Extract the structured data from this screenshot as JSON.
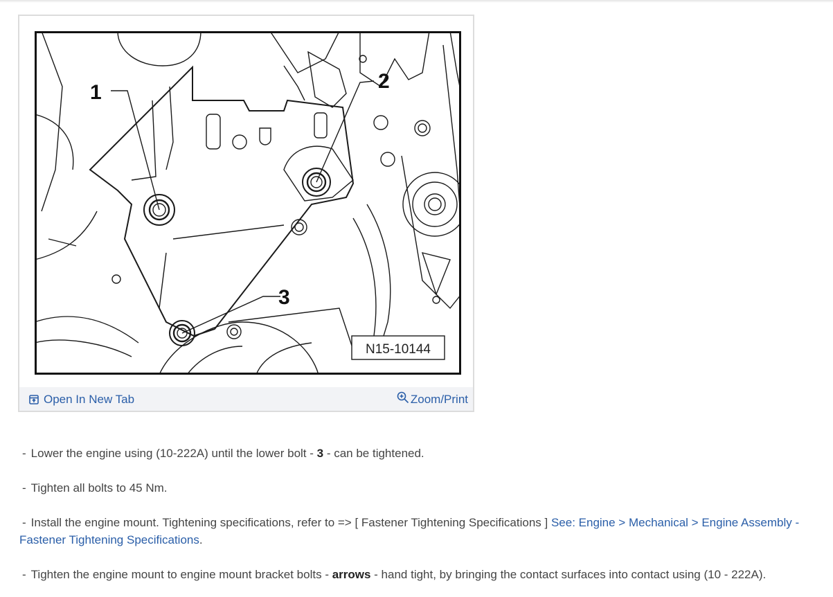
{
  "figure": {
    "image_code": "N15-10144",
    "callouts": [
      "1",
      "2",
      "3"
    ],
    "open_label": "Open In New Tab",
    "zoom_label": "Zoom/Print",
    "open_icon": "open-in-new-tab-icon",
    "zoom_icon": "zoom-in-icon",
    "link_color": "#2a5ea8"
  },
  "steps": [
    {
      "dash": "-",
      "pre": "Lower the engine using (10-222A) until the lower bolt - ",
      "bold": "3",
      "post": " - can be tightened."
    },
    {
      "dash": "-",
      "text": "Tighten all bolts to 45 Nm."
    },
    {
      "dash": "-",
      "pre": "Install the engine mount. Tightening specifications, refer to => [ Fastener Tightening Specifications ] ",
      "link": "See: Engine > Mechanical > Engine Assembly - Fastener Tightening Specifications",
      "post": "."
    },
    {
      "dash": "-",
      "pre": "Tighten the engine mount to engine mount bracket bolts - ",
      "bold": "arrows",
      "post": " - hand tight, by bringing the contact surfaces into contact using (10 - 222A)."
    }
  ]
}
